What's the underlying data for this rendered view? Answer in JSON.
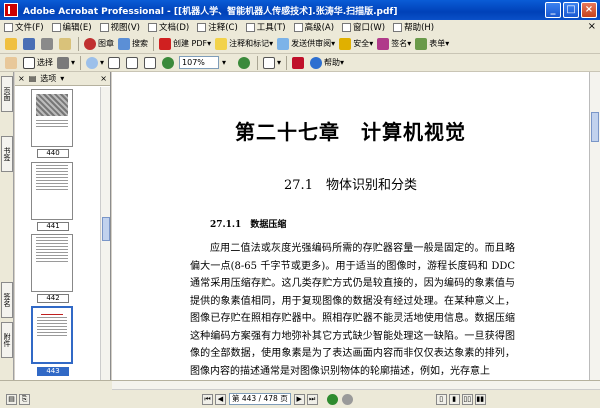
{
  "window": {
    "title": "Adobe Acrobat Professional - [[机器人学、智能机器人传感技术].张涛华.扫描版.pdf]"
  },
  "menu": {
    "items": [
      {
        "label": "文件(F)",
        "icon": "file-icon"
      },
      {
        "label": "编辑(E)",
        "icon": "edit-icon"
      },
      {
        "label": "视图(V)",
        "icon": "view-icon"
      },
      {
        "label": "文档(D)",
        "icon": "document-icon"
      },
      {
        "label": "注释(C)",
        "icon": "comment-icon"
      },
      {
        "label": "工具(T)",
        "icon": "tools-icon"
      },
      {
        "label": "高级(A)",
        "icon": "advanced-icon"
      },
      {
        "label": "窗口(W)",
        "icon": "window-icon"
      },
      {
        "label": "帮助(H)",
        "icon": "help-icon"
      }
    ]
  },
  "toolbar1": {
    "create_pdf": "创建 PDF",
    "review": "注释和标记",
    "send_review": "发送供审阅",
    "secure": "安全",
    "sign": "签名",
    "forms": "表单",
    "print_label": "图章",
    "search_label": "搜索"
  },
  "toolbar2": {
    "select_label": "选择",
    "zoom_value": "107%",
    "help_label": "帮助"
  },
  "panel": {
    "tab_label": "选项",
    "side_tabs": [
      "页面",
      "书签",
      "签名",
      "附件"
    ],
    "thumbnails": [
      {
        "label": "440",
        "selected": false
      },
      {
        "label": "441",
        "selected": false
      },
      {
        "label": "442",
        "selected": false
      },
      {
        "label": "443",
        "selected": true
      }
    ]
  },
  "page": {
    "chapter_title": "第二十七章　计算机视觉",
    "section_title": "27.1　物体识别和分类",
    "subsection_title": "27.1.1　数据压缩",
    "paragraph": "应用二值法或灰度光强编码所需的存贮器容量一般是固定的。而且略偏大一点(8-65 千字节或更多)。用于适当的图像时，游程长度码和 DDC 通常采用压缩存贮。这几类存贮方式仍是较直接的，因为编码的象素值与提供的象素值相同，用于复现图像的数据没有经过处理。在某种意义上，图像已存贮在照相存贮器中。照相存贮器不能灵活地使用信息。数据压缩这种编码方案强有力地弥补其它方式缺少智能处理这一缺陷。一旦获得图像的全部数据，使用象素是为了表达画面内容而非仅仅表达象素的排列，图像内容的描述通常是对图像识别物体的轮廓描述，例如，光存意上"
  },
  "statusbar": {
    "page_indicator": "第 443 / 478 页"
  }
}
